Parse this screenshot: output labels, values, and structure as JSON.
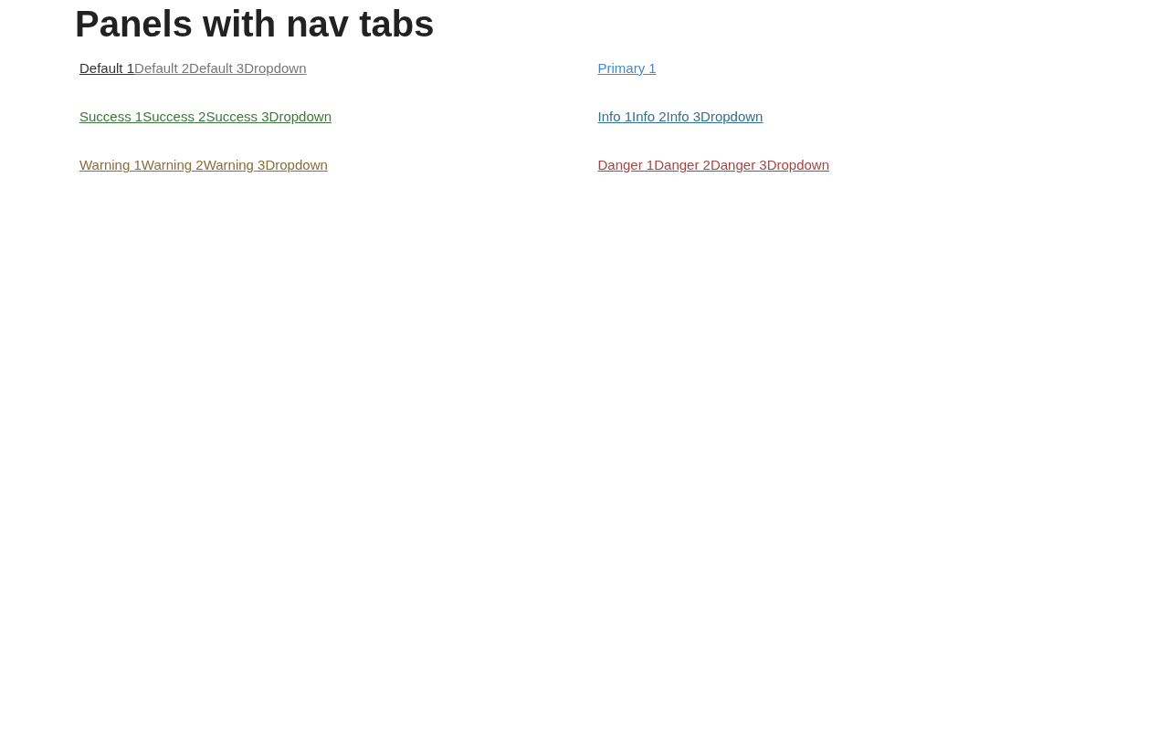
{
  "title": "Panels with nav tabs",
  "panels": [
    {
      "color": "#777777",
      "tabs": [
        {
          "label": "Default 1",
          "selected": true
        },
        {
          "label": "Default 2",
          "selected": false
        },
        {
          "label": "Default 3",
          "selected": false
        },
        {
          "label": "Dropdown",
          "selected": false
        }
      ]
    },
    {
      "color": "#428bca",
      "tabs": [
        {
          "label": "Primary 1"
        }
      ]
    },
    {
      "color": "#3c763d",
      "tabs": [
        {
          "label": "Success 1"
        },
        {
          "label": "Success 2"
        },
        {
          "label": "Success 3"
        },
        {
          "label": "Dropdown"
        }
      ]
    },
    {
      "color": "#31708f",
      "tabs": [
        {
          "label": "Info 1"
        },
        {
          "label": "Info 2"
        },
        {
          "label": "Info 3"
        },
        {
          "label": "Dropdown"
        }
      ]
    },
    {
      "color": "#8a6d3b",
      "tabs": [
        {
          "label": "Warning 1"
        },
        {
          "label": "Warning 2"
        },
        {
          "label": "Warning 3"
        },
        {
          "label": "Dropdown"
        }
      ]
    },
    {
      "color": "#a94442",
      "tabs": [
        {
          "label": "Danger 1"
        },
        {
          "label": "Danger 2"
        },
        {
          "label": "Danger 3"
        },
        {
          "label": "Dropdown"
        }
      ]
    }
  ]
}
